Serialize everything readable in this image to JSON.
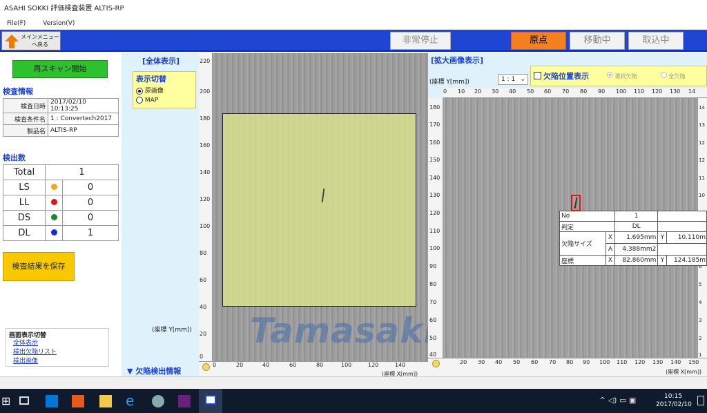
{
  "window": {
    "title": "ASAHI SOKKI 評価検査装置 ALTIS-RP"
  },
  "menu": {
    "file": "File(F)",
    "version": "Version(V)"
  },
  "toolbar": {
    "main_menu": "メインメニューへ戻る",
    "emergency_stop": "非常停止",
    "origin": "原点",
    "moving": "移動中",
    "capture": "取込中"
  },
  "left": {
    "rescan_button": "再スキャン開始",
    "inspection_info_title": "検査情報",
    "info_rows": [
      {
        "label": "検査日時",
        "value": "2017/02/10 10:13:25"
      },
      {
        "label": "検査条件名",
        "value": "1 : Convertech2017"
      },
      {
        "label": "製品名",
        "value": "ALTIS-RP"
      }
    ],
    "count_title": "検出数",
    "total_label": "Total",
    "total_value": "1",
    "counts": [
      {
        "label": "LS",
        "color": "#f5a623",
        "value": "0"
      },
      {
        "label": "LL",
        "color": "#e0161c",
        "value": "0"
      },
      {
        "label": "DS",
        "color": "#1b8a25",
        "value": "0"
      },
      {
        "label": "DL",
        "color": "#1a2ad6",
        "value": "1"
      }
    ],
    "save_button": "検査結果を保存",
    "view_switch_title": "画面表示切替",
    "view_links": [
      "全体表示",
      "検出欠陥リスト",
      "検出画像"
    ]
  },
  "middle": {
    "overall_title": "[全体表示]",
    "display_switch": "表示切替",
    "opt_original": "原画像",
    "opt_map": "MAP",
    "ylabel": "(座標 Y[mm])",
    "defect_info": "▼ 欠陥検出情報"
  },
  "overview": {
    "y_ticks": [
      "220",
      "200",
      "180",
      "160",
      "140",
      "120",
      "100",
      "80",
      "60",
      "40",
      "20",
      "0"
    ],
    "x_ticks": [
      "0",
      "20",
      "40",
      "60",
      "80",
      "100",
      "120",
      "140"
    ],
    "xlabel": "(座標 X[mm])"
  },
  "zoom": {
    "title": "[拡大画像表示]",
    "ylabel": "(座標 Y[mm])",
    "scale": "1 : 1",
    "defect_pos": "欠陥位置表示",
    "opt_selected": "選択欠陥",
    "opt_all": "全欠陥",
    "top_ticks": [
      "0",
      "10",
      "20",
      "30",
      "40",
      "50",
      "60",
      "70",
      "80",
      "90",
      "100",
      "110",
      "120",
      "130",
      "14"
    ],
    "left_ticks": [
      "180",
      "170",
      "160",
      "150",
      "140",
      "130",
      "120",
      "110",
      "100",
      "90",
      "80",
      "70",
      "60",
      "50",
      "40"
    ],
    "right_ticks": [
      "14",
      "13",
      "12",
      "12",
      "11",
      "10",
      "9",
      "8",
      "7",
      "6",
      "5",
      "4",
      "3",
      "2",
      "1"
    ],
    "bottom_ticks": [
      "20",
      "30",
      "40",
      "50",
      "60",
      "70",
      "80",
      "90",
      "100",
      "110",
      "120",
      "130",
      "140",
      "150"
    ],
    "xlabel": "(座標 X[mm])"
  },
  "defect_table": {
    "no_label": "No",
    "no_value": "1",
    "judge_label": "判定",
    "judge_value": "DL",
    "size_label": "欠陥サイズ",
    "x_label": "X",
    "size_x": "1.695mm",
    "y_label": "Y",
    "size_y": "10.110m",
    "a_label": "A",
    "area": "4.388mm2",
    "coord_label": "座標",
    "coord_x": "82.860mm",
    "coord_y": "124.185m"
  },
  "watermark": "Tamasaki",
  "taskbar": {
    "time": "10:15",
    "date": "2017/02/10"
  }
}
